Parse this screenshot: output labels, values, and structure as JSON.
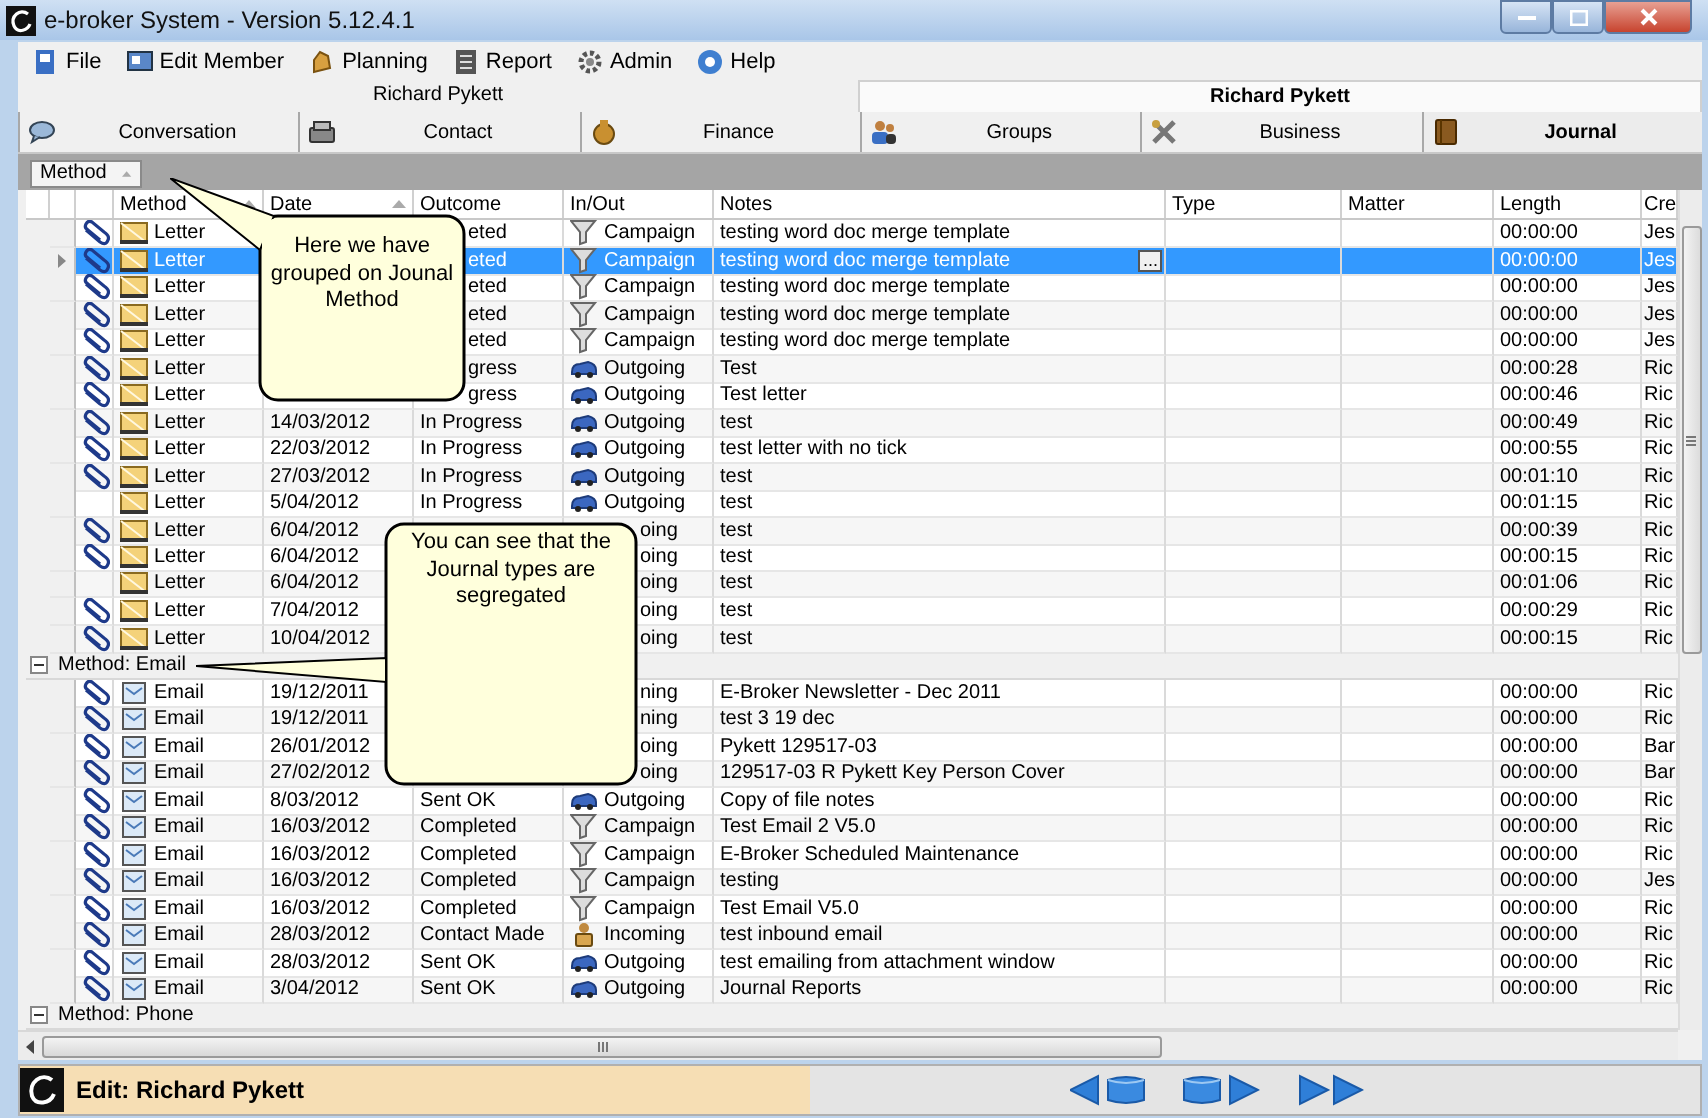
{
  "window": {
    "title": "e-broker System - Version 5.12.4.1"
  },
  "menu": [
    {
      "label": "File"
    },
    {
      "label": "Edit Member"
    },
    {
      "label": "Planning"
    },
    {
      "label": "Report"
    },
    {
      "label": "Admin"
    },
    {
      "label": "Help"
    }
  ],
  "member_bar": {
    "left": "Richard Pykett",
    "right": "Richard Pykett"
  },
  "tabs": [
    {
      "label": "Conversation",
      "selected": false
    },
    {
      "label": "Contact",
      "selected": false
    },
    {
      "label": "Finance",
      "selected": false
    },
    {
      "label": "Groups",
      "selected": false
    },
    {
      "label": "Business",
      "selected": false
    },
    {
      "label": "Journal",
      "selected": true
    }
  ],
  "group_by": {
    "chips": [
      {
        "label": "Method",
        "sorted": true
      }
    ]
  },
  "columns": [
    {
      "label": "Method",
      "sorted": true
    },
    {
      "label": "Date",
      "sorted": true
    },
    {
      "label": "Outcome"
    },
    {
      "label": "In/Out"
    },
    {
      "label": "Notes"
    },
    {
      "label": "Type"
    },
    {
      "label": "Matter"
    },
    {
      "label": "Length"
    },
    {
      "label": "Cre"
    }
  ],
  "groups": [
    {
      "rows": [
        {
          "attached": true,
          "method": {
            "kind": "letter",
            "text": "Letter"
          },
          "outcome_tail": "eted",
          "in_out": {
            "kind": "campaign",
            "text": "Campaign"
          },
          "notes": "testing word doc merge template",
          "length": "00:00:00",
          "column_9": "Jes",
          "selected": false
        },
        {
          "attached": true,
          "method": {
            "kind": "letter",
            "text": "Letter"
          },
          "outcome_tail": "eted",
          "in_out": {
            "kind": "campaign",
            "text": "Campaign"
          },
          "notes": "testing word doc merge template",
          "edit_button": "...",
          "length": "00:00:00",
          "column_9": "Jes",
          "selected": true
        },
        {
          "attached": true,
          "method": {
            "kind": "letter",
            "text": "Letter"
          },
          "outcome_tail": "eted",
          "in_out": {
            "kind": "campaign",
            "text": "Campaign"
          },
          "notes": "testing word doc merge template",
          "length": "00:00:00",
          "column_9": "Jes",
          "selected": false
        },
        {
          "attached": true,
          "method": {
            "kind": "letter",
            "text": "Letter"
          },
          "outcome_tail": "eted",
          "in_out": {
            "kind": "campaign",
            "text": "Campaign"
          },
          "notes": "testing word doc merge template",
          "length": "00:00:00",
          "column_9": "Jes",
          "selected": false
        },
        {
          "attached": true,
          "method": {
            "kind": "letter",
            "text": "Letter"
          },
          "outcome_tail": "eted",
          "in_out": {
            "kind": "campaign",
            "text": "Campaign"
          },
          "notes": "testing word doc merge template",
          "length": "00:00:00",
          "column_9": "Jes",
          "selected": false
        },
        {
          "attached": true,
          "method": {
            "kind": "letter",
            "text": "Letter"
          },
          "outcome_tail": "gress",
          "in_out": {
            "kind": "outgoing",
            "text": "Outgoing"
          },
          "notes": "Test",
          "length": "00:00:28",
          "column_9": "Ric",
          "selected": false
        },
        {
          "attached": true,
          "method": {
            "kind": "letter",
            "text": "Letter"
          },
          "outcome_tail": "gress",
          "in_out": {
            "kind": "outgoing",
            "text": "Outgoing"
          },
          "notes": "Test letter",
          "length": "00:00:46",
          "column_9": "Ric",
          "selected": false
        },
        {
          "attached": true,
          "method": {
            "kind": "letter",
            "text": "Letter"
          },
          "date": "14/03/2012",
          "outcome": "In Progress",
          "in_out": {
            "kind": "outgoing",
            "text": "Outgoing"
          },
          "notes": "test",
          "length": "00:00:49",
          "column_9": "Ric",
          "selected": false
        },
        {
          "attached": true,
          "method": {
            "kind": "letter",
            "text": "Letter"
          },
          "date": "22/03/2012",
          "outcome": "In Progress",
          "in_out": {
            "kind": "outgoing",
            "text": "Outgoing"
          },
          "notes": "test letter with no tick",
          "length": "00:00:55",
          "column_9": "Ric",
          "selected": false
        },
        {
          "attached": true,
          "method": {
            "kind": "letter",
            "text": "Letter"
          },
          "date": "27/03/2012",
          "outcome": "In Progress",
          "in_out": {
            "kind": "outgoing",
            "text": "Outgoing"
          },
          "notes": "test",
          "length": "00:01:10",
          "column_9": "Ric",
          "selected": false
        },
        {
          "attached": false,
          "method": {
            "kind": "letter",
            "text": "Letter"
          },
          "date": "5/04/2012",
          "outcome": "In Progress",
          "in_out": {
            "kind": "outgoing",
            "text": "Outgoing"
          },
          "notes": "test",
          "length": "00:01:15",
          "column_9": "Ric",
          "selected": false
        },
        {
          "attached": true,
          "method": {
            "kind": "letter",
            "text": "Letter"
          },
          "date": "6/04/2012",
          "in_out_tail": "oing",
          "notes": "test",
          "length": "00:00:39",
          "column_9": "Ric",
          "selected": false
        },
        {
          "attached": true,
          "method": {
            "kind": "letter",
            "text": "Letter"
          },
          "date": "6/04/2012",
          "in_out_tail": "oing",
          "notes": "test",
          "length": "00:00:15",
          "column_9": "Ric",
          "selected": false
        },
        {
          "attached": false,
          "method": {
            "kind": "letter",
            "text": "Letter"
          },
          "date": "6/04/2012",
          "in_out_tail": "oing",
          "notes": "test",
          "length": "00:01:06",
          "column_9": "Ric",
          "selected": false
        },
        {
          "attached": true,
          "method": {
            "kind": "letter",
            "text": "Letter"
          },
          "date": "7/04/2012",
          "in_out_tail": "oing",
          "notes": "test",
          "length": "00:00:29",
          "column_9": "Ric",
          "selected": false
        },
        {
          "attached": true,
          "method": {
            "kind": "letter",
            "text": "Letter"
          },
          "date": "10/04/2012",
          "in_out_tail": "oing",
          "notes": "test",
          "length": "00:00:15",
          "column_9": "Ric",
          "selected": false
        }
      ]
    },
    {
      "header": "Method:  Email",
      "expanded": true,
      "rows": [
        {
          "attached": true,
          "method": {
            "kind": "email",
            "text": "Email"
          },
          "date": "19/12/2011",
          "in_out_tail": "ning",
          "notes": "E-Broker Newsletter - Dec 2011",
          "length": "00:00:00",
          "column_9": "Ric",
          "selected": false
        },
        {
          "attached": true,
          "method": {
            "kind": "email",
            "text": "Email"
          },
          "date": "19/12/2011",
          "in_out_tail": "ning",
          "notes": "test 3 19 dec",
          "length": "00:00:00",
          "column_9": "Ric",
          "selected": false
        },
        {
          "attached": true,
          "method": {
            "kind": "email",
            "text": "Email"
          },
          "date": "26/01/2012",
          "in_out_tail": "oing",
          "notes": "Pykett 129517-03",
          "length": "00:00:00",
          "column_9": "Bar",
          "selected": false
        },
        {
          "attached": true,
          "method": {
            "kind": "email",
            "text": "Email"
          },
          "date": "27/02/2012",
          "in_out_tail": "oing",
          "notes": "129517-03 R Pykett Key Person Cover",
          "length": "00:00:00",
          "column_9": "Bar",
          "selected": false
        },
        {
          "attached": true,
          "method": {
            "kind": "email",
            "text": "Email"
          },
          "date": "8/03/2012",
          "outcome": "Sent OK",
          "in_out": {
            "kind": "outgoing",
            "text": "Outgoing"
          },
          "notes": "Copy of file notes",
          "length": "00:00:00",
          "column_9": "Ric",
          "selected": false
        },
        {
          "attached": true,
          "method": {
            "kind": "email",
            "text": "Email"
          },
          "date": "16/03/2012",
          "outcome": "Completed",
          "in_out": {
            "kind": "campaign",
            "text": "Campaign"
          },
          "notes": "Test Email 2 V5.0",
          "length": "00:00:00",
          "column_9": "Ric",
          "selected": false
        },
        {
          "attached": true,
          "method": {
            "kind": "email",
            "text": "Email"
          },
          "date": "16/03/2012",
          "outcome": "Completed",
          "in_out": {
            "kind": "campaign",
            "text": "Campaign"
          },
          "notes": "E-Broker Scheduled Maintenance",
          "length": "00:00:00",
          "column_9": "Ric",
          "selected": false
        },
        {
          "attached": true,
          "method": {
            "kind": "email",
            "text": "Email"
          },
          "date": "16/03/2012",
          "outcome": "Completed",
          "in_out": {
            "kind": "campaign",
            "text": "Campaign"
          },
          "notes": "testing",
          "length": "00:00:00",
          "column_9": "Jes",
          "selected": false
        },
        {
          "attached": true,
          "method": {
            "kind": "email",
            "text": "Email"
          },
          "date": "16/03/2012",
          "outcome": "Completed",
          "in_out": {
            "kind": "campaign",
            "text": "Campaign"
          },
          "notes": "Test Email V5.0",
          "length": "00:00:00",
          "column_9": "Ric",
          "selected": false
        },
        {
          "attached": true,
          "method": {
            "kind": "email",
            "text": "Email"
          },
          "date": "28/03/2012",
          "outcome": "Contact Made",
          "in_out": {
            "kind": "incoming",
            "text": "Incoming"
          },
          "notes": "test inbound email",
          "length": "00:00:00",
          "column_9": "Ric",
          "selected": false
        },
        {
          "attached": true,
          "method": {
            "kind": "email",
            "text": "Email"
          },
          "date": "28/03/2012",
          "outcome": "Sent OK",
          "in_out": {
            "kind": "outgoing",
            "text": "Outgoing"
          },
          "notes": "test emailing from attachment window",
          "length": "00:00:00",
          "column_9": "Ric",
          "selected": false
        },
        {
          "attached": true,
          "method": {
            "kind": "email",
            "text": "Email"
          },
          "date": "3/04/2012",
          "outcome": "Sent OK",
          "in_out": {
            "kind": "outgoing",
            "text": "Outgoing"
          },
          "notes": "Journal Reports",
          "length": "00:00:00",
          "column_9": "Ric",
          "selected": false
        }
      ]
    },
    {
      "header": "Method:  Phone",
      "expanded": true
    }
  ],
  "callouts": [
    {
      "text": "Here we have grouped on Jounal Method"
    },
    {
      "text": "You can see that the Journal types are segregated"
    }
  ],
  "status_bar": {
    "text": "Edit: Richard Pykett"
  }
}
